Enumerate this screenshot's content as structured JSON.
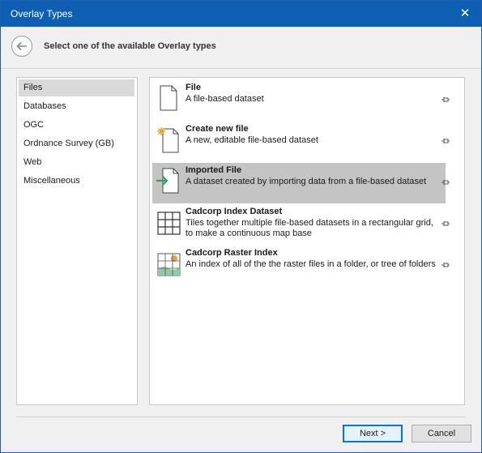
{
  "window": {
    "title": "Overlay Types",
    "close_glyph": "✕"
  },
  "header": {
    "text": "Select one of the available Overlay types",
    "back_icon": "back-arrow-icon"
  },
  "categories": [
    {
      "label": "Files",
      "selected": true
    },
    {
      "label": "Databases",
      "selected": false
    },
    {
      "label": "OGC",
      "selected": false
    },
    {
      "label": "Ordnance Survey (GB)",
      "selected": false
    },
    {
      "label": "Web",
      "selected": false
    },
    {
      "label": "Miscellaneous",
      "selected": false
    }
  ],
  "items": [
    {
      "title": "File",
      "desc": "A file-based dataset",
      "icon": "file-icon",
      "selected": false
    },
    {
      "title": "Create new file",
      "desc": "A new, editable file-based dataset",
      "icon": "new-file-icon",
      "selected": false
    },
    {
      "title": "Imported File",
      "desc": "A dataset created by importing data from a file-based dataset",
      "icon": "import-file-icon",
      "selected": true
    },
    {
      "title": "Cadcorp Index Dataset",
      "desc": "Tiles together multiple file-based datasets in a rectangular grid, to make a continuous map base",
      "icon": "grid-icon",
      "selected": false
    },
    {
      "title": "Cadcorp Raster Index",
      "desc": "An index of all of the the raster files in a folder, or tree of folders",
      "icon": "raster-index-icon",
      "selected": false
    }
  ],
  "buttons": {
    "next": "Next >",
    "cancel": "Cancel"
  },
  "colors": {
    "titlebar": "#0e5fb4",
    "selection": "#c4c4c4",
    "accent": "#0078d7"
  }
}
